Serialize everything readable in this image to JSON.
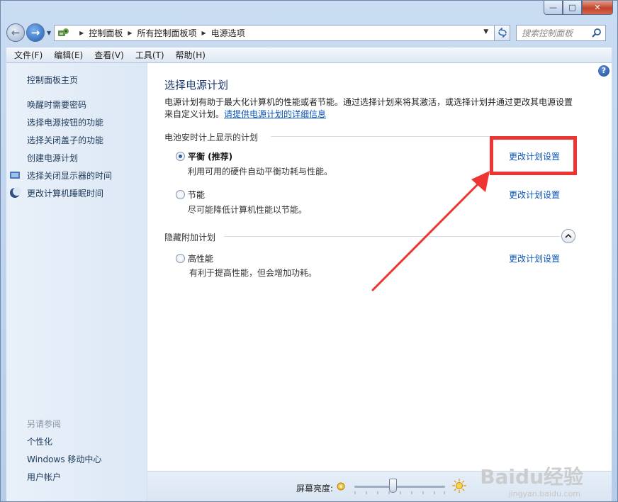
{
  "window": {
    "minimize": "—",
    "maximize": "□",
    "close": "✕"
  },
  "address": {
    "crumbs": [
      "控制面板",
      "所有控制面板项",
      "电源选项"
    ],
    "search_placeholder": "搜索控制面板"
  },
  "menu": [
    "文件(F)",
    "编辑(E)",
    "查看(V)",
    "工具(T)",
    "帮助(H)"
  ],
  "sidebar": {
    "home": "控制面板主页",
    "links": [
      "唤醒时需要密码",
      "选择电源按钮的功能",
      "选择关闭盖子的功能",
      "创建电源计划",
      "选择关闭显示器的时间",
      "更改计算机睡眠时间"
    ],
    "see_also_heading": "另请参阅",
    "see_also": [
      "个性化",
      "Windows 移动中心",
      "用户帐户"
    ]
  },
  "main": {
    "title": "选择电源计划",
    "desc_text": "电源计划有助于最大化计算机的性能或者节能。通过选择计划来将其激活，或选择计划并通过更改其电源设置来自定义计划。",
    "desc_link": "请提供电源计划的详细信息",
    "group1_heading": "电池安时计上显示的计划",
    "group2_heading": "隐藏附加计划",
    "plans": [
      {
        "name": "平衡 (推荐)",
        "desc": "利用可用的硬件自动平衡功耗与性能。",
        "link": "更改计划设置",
        "selected": true
      },
      {
        "name": "节能",
        "desc": "尽可能降低计算机性能以节能。",
        "link": "更改计划设置",
        "selected": false
      },
      {
        "name": "高性能",
        "desc": "有利于提高性能，但会增加功耗。",
        "link": "更改计划设置",
        "selected": false
      }
    ]
  },
  "bottom": {
    "brightness_label": "屏幕亮度:",
    "brightness_level": 0.43
  },
  "watermark": {
    "brand": "Baidu经验",
    "url": "jingyan.baidu.com"
  },
  "colors": {
    "annotation": "#ee3532",
    "link": "#0a56b8"
  }
}
